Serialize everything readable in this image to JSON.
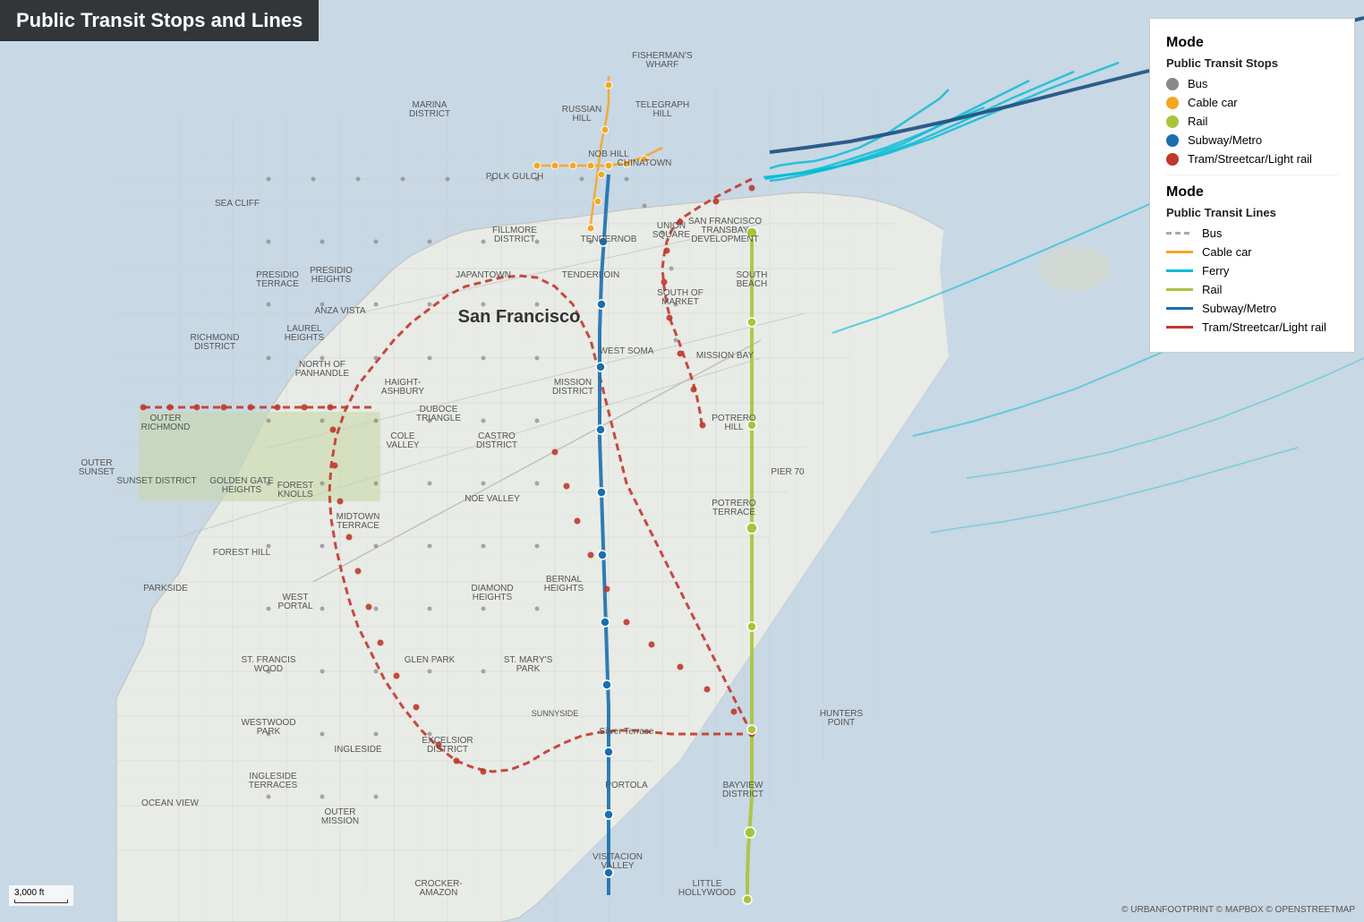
{
  "title": "Public Transit Stops and Lines",
  "legend": {
    "stops_section_title": "Mode",
    "stops_subtitle": "Public Transit Stops",
    "stops_items": [
      {
        "label": "Bus",
        "color": "#888888"
      },
      {
        "label": "Cable car",
        "color": "#f5a623"
      },
      {
        "label": "Rail",
        "color": "#a8c43a"
      },
      {
        "label": "Subway/Metro",
        "color": "#1a6faf"
      },
      {
        "label": "Tram/Streetcar/Light rail",
        "color": "#c0392b"
      }
    ],
    "lines_section_title": "Mode",
    "lines_subtitle": "Public Transit Lines",
    "lines_items": [
      {
        "label": "Bus",
        "color": "#aaaaaa",
        "dashed": true
      },
      {
        "label": "Cable car",
        "color": "#f5a623",
        "dashed": false
      },
      {
        "label": "Ferry",
        "color": "#00bcd4",
        "dashed": false
      },
      {
        "label": "Rail",
        "color": "#a8c43a",
        "dashed": false
      },
      {
        "label": "Subway/Metro",
        "color": "#1a6faf",
        "dashed": false
      },
      {
        "label": "Tram/Streetcar/Light rail",
        "color": "#c0392b",
        "dashed": false
      }
    ]
  },
  "scale": "3,000 ft",
  "copyright": "© URBANFOOTPRINT © MAPBOX © OPENSTREETMAP"
}
